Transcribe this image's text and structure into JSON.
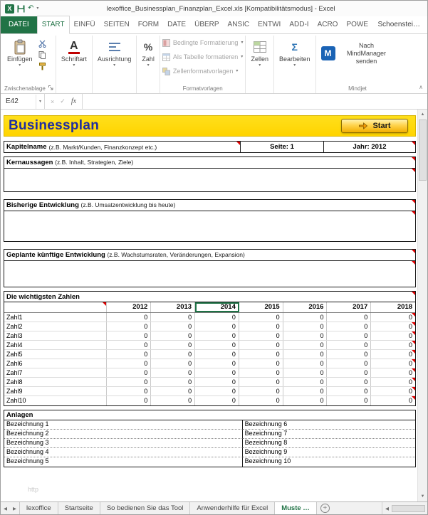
{
  "titlebar": {
    "title": "lexoffice_Businessplan_Finanzplan_Excel.xls  [Kompatibilitätsmodus] - Excel"
  },
  "ribbon": {
    "tabs": [
      {
        "id": "datei",
        "label": "DATEI",
        "type": "file"
      },
      {
        "id": "start",
        "label": "START",
        "type": "active"
      },
      {
        "id": "einfuegen",
        "label": "EINFÜ"
      },
      {
        "id": "seitenlayout",
        "label": "SEITEN"
      },
      {
        "id": "formeln",
        "label": "FORM"
      },
      {
        "id": "daten",
        "label": "DATE"
      },
      {
        "id": "ueberpruefen",
        "label": "ÜBERP"
      },
      {
        "id": "ansicht",
        "label": "ANSIC"
      },
      {
        "id": "entwicklertools",
        "label": "ENTWI"
      },
      {
        "id": "addins",
        "label": "ADD-I"
      },
      {
        "id": "acrobat",
        "label": "ACRO"
      },
      {
        "id": "powerpivot",
        "label": "POWE"
      },
      {
        "id": "account",
        "label": "Schoenstei…",
        "type": "account"
      }
    ],
    "clipboard": {
      "paste_label": "Einfügen",
      "group_label": "Zwischenablage"
    },
    "font_group": "Schriftart",
    "alignment_group": "Ausrichtung",
    "number_group": "Zahl",
    "styles": {
      "group_label": "Formatvorlagen",
      "conditional": "Bedingte Formatierung",
      "format_table": "Als Tabelle formatieren",
      "cell_styles": "Zellenformatvorlagen"
    },
    "cells_group": "Zellen",
    "editing_group": "Bearbeiten",
    "mindjet": {
      "button_label": "Nach MindManager senden",
      "group_label": "Mindjet"
    }
  },
  "formula_bar": {
    "name_box": "E42",
    "formula_value": ""
  },
  "sheet": {
    "banner": {
      "title": "Businessplan",
      "start_button": "Start"
    },
    "kapitel": {
      "label": "Kapitelname",
      "hint": "(z.B. Markt/Kunden, Finanzkonzept etc.)",
      "seite": "Seite: 1",
      "jahr": "Jahr: 2012"
    },
    "sections": [
      {
        "label": "Kernaussagen",
        "hint": "(z.B. Inhalt, Strategien, Ziele)"
      },
      {
        "label": "Bisherige Entwicklung",
        "hint": "(z.B. Umsatzentwicklung bis heute)"
      },
      {
        "label": "Geplante künftige Entwicklung",
        "hint": "(z.B. Wachstumsraten, Veränderungen, Expansion)"
      }
    ],
    "numbers": {
      "title": "Die wichtigsten Zahlen",
      "years": [
        "2012",
        "2013",
        "2014",
        "2015",
        "2016",
        "2017",
        "2018"
      ],
      "selected_year": "2014",
      "rows": [
        {
          "label": "Zahl1",
          "values": [
            "0",
            "0",
            "0",
            "0",
            "0",
            "0",
            "0"
          ]
        },
        {
          "label": "Zahl2",
          "values": [
            "0",
            "0",
            "0",
            "0",
            "0",
            "0",
            "0"
          ]
        },
        {
          "label": "Zahl3",
          "values": [
            "0",
            "0",
            "0",
            "0",
            "0",
            "0",
            "0"
          ]
        },
        {
          "label": "Zahl4",
          "values": [
            "0",
            "0",
            "0",
            "0",
            "0",
            "0",
            "0"
          ]
        },
        {
          "label": "Zahl5",
          "values": [
            "0",
            "0",
            "0",
            "0",
            "0",
            "0",
            "0"
          ]
        },
        {
          "label": "Zahl6",
          "values": [
            "0",
            "0",
            "0",
            "0",
            "0",
            "0",
            "0"
          ]
        },
        {
          "label": "Zahl7",
          "values": [
            "0",
            "0",
            "0",
            "0",
            "0",
            "0",
            "0"
          ]
        },
        {
          "label": "Zahl8",
          "values": [
            "0",
            "0",
            "0",
            "0",
            "0",
            "0",
            "0"
          ]
        },
        {
          "label": "Zahl9",
          "values": [
            "0",
            "0",
            "0",
            "0",
            "0",
            "0",
            "0"
          ]
        },
        {
          "label": "Zahl10",
          "values": [
            "0",
            "0",
            "0",
            "0",
            "0",
            "0",
            "0"
          ]
        }
      ]
    },
    "anlagen": {
      "title": "Anlagen",
      "rows": [
        {
          "left": "Bezeichnung 1",
          "right": "Bezeichnung 6"
        },
        {
          "left": "Bezeichnung 2",
          "right": "Bezeichnung 7"
        },
        {
          "left": "Bezeichnung 3",
          "right": "Bezeichnung 8"
        },
        {
          "left": "Bezeichnung 4",
          "right": "Bezeichnung 9"
        },
        {
          "left": "Bezeichnung 5",
          "right": "Bezeichnung 10"
        }
      ]
    },
    "watermark": "http"
  },
  "sheet_tabs": {
    "tabs": [
      {
        "label": "lexoffice",
        "active": false
      },
      {
        "label": "Startseite",
        "active": false
      },
      {
        "label": "So bedienen Sie das Tool",
        "active": false
      },
      {
        "label": "Anwenderhilfe für Excel",
        "active": false
      },
      {
        "label": "Muste …",
        "active": true
      }
    ]
  },
  "glyphs": {
    "caret_down": "▾",
    "tab_prev": "◀",
    "tab_next": "▶",
    "scroll_up": "▲",
    "scroll_down": "▼",
    "cancel": "×",
    "enter": "✓",
    "fx": "fx",
    "add_sheet": "+",
    "percent": "%",
    "font_a": "A",
    "sigma": "Σ",
    "collapse": "∧",
    "undo": "↶",
    "mind_m": "M",
    "excel_x": "X"
  },
  "colors": {
    "excel_green": "#217346",
    "banner_yellow": "#ffd400",
    "banner_text_blue": "#1f2da0",
    "comment_red": "#e00000",
    "selection_green": "#1e7145"
  }
}
